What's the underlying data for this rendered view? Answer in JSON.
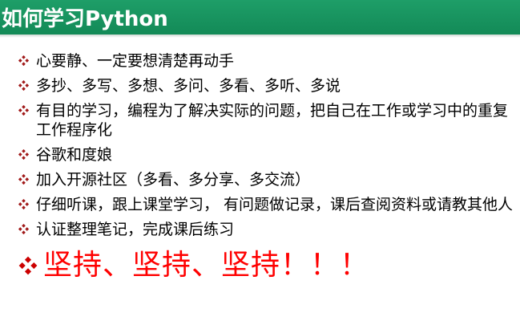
{
  "title": "如何学习Python",
  "colors": {
    "title_bg": "#138a57",
    "title_text": "#ffffff",
    "bullet_marker": "#a01818",
    "body_text": "#000000",
    "emphasis_text": "#ff0000"
  },
  "bullet_icon": "four-diamond-icon",
  "items": [
    "心要静、一定要想清楚再动手",
    "多抄、多写、多想、多问、多看、多听、多说",
    "有目的学习，编程为了解决实际的问题，把自己在工作或学习中的重复工作程序化",
    "谷歌和度娘",
    "加入开源社区（多看、多分享、多交流）",
    "仔细听课，跟上课堂学习， 有问题做记录，课后查阅资料或请教其他人",
    "认证整理笔记，完成课后练习"
  ],
  "emphasis": "坚持、坚持、坚持！！！"
}
